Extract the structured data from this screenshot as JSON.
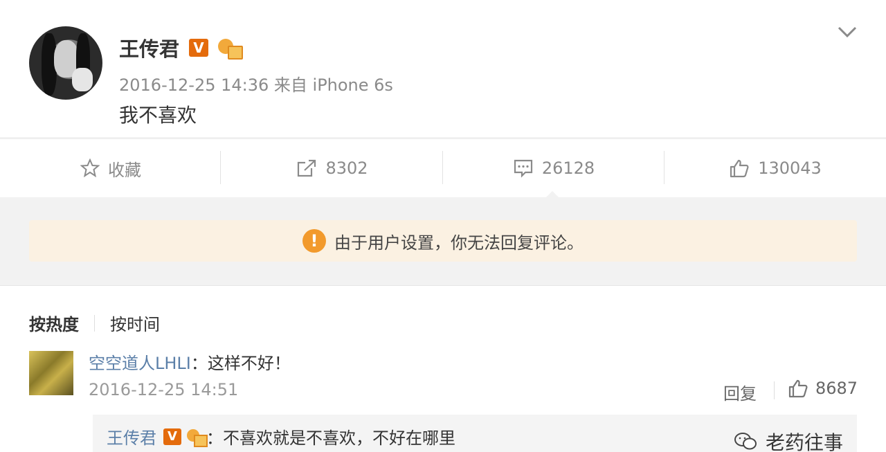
{
  "post": {
    "author": "王传君",
    "verified_badge": "V",
    "timestamp": "2016-12-25 14:36 来自 iPhone 6s",
    "text": "我不喜欢"
  },
  "actions": {
    "favorite_label": "收藏",
    "repost_count": "8302",
    "comment_count": "26128",
    "like_count": "130043"
  },
  "notice": {
    "text": "由于用户设置，你无法回复评论。",
    "icon": "warning-icon"
  },
  "sort": {
    "by_hot": "按热度",
    "by_time": "按时间"
  },
  "comment": {
    "user": "空空道人LHLI",
    "text": "：这样不好！",
    "time": "2016-12-25 14:51",
    "reply_label": "回复",
    "likes": "8687"
  },
  "sub_reply": {
    "user": "王传君",
    "verified_badge": "V",
    "text": "：不喜欢就是不喜欢，不好在哪里"
  },
  "watermark": {
    "text": "老药往事"
  },
  "colors": {
    "link": "#5b7fa8",
    "verified": "#e46b0c",
    "notice_bg": "#fbf1e2",
    "warning": "#f29a2c"
  }
}
